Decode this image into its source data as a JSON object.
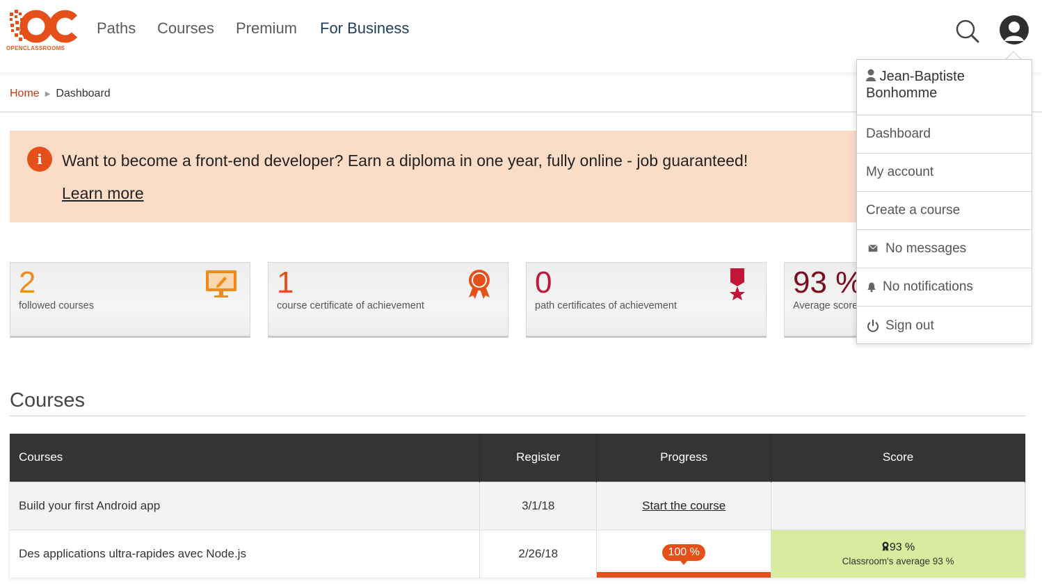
{
  "header": {
    "logo_text": "OPENCLASSROOMS",
    "nav": [
      {
        "label": "Paths"
      },
      {
        "label": "Courses"
      },
      {
        "label": "Premium"
      },
      {
        "label": "For Business"
      }
    ],
    "icons": [
      "search-icon",
      "user-avatar-icon"
    ]
  },
  "breadcrumb": {
    "home": "Home",
    "current": "Dashboard"
  },
  "banner": {
    "icon": "info-icon",
    "text": "Want to become a front-end developer? Earn a diploma in one year, fully online - job guaranteed!",
    "link": "Learn more",
    "color": "#fbdcc7"
  },
  "stats": [
    {
      "value": "2",
      "label": "followed courses",
      "icon": "monitor-pencil-icon",
      "color": "#f08a1c"
    },
    {
      "value": "1",
      "label": "course certificate of achievement",
      "icon": "ribbon-award-icon",
      "color": "#e5501a"
    },
    {
      "value": "0",
      "label": "path certificates of achievement",
      "icon": "star-medal-icon",
      "color": "#c0163a"
    },
    {
      "value": "93 %",
      "label": "Average score",
      "color": "#7a0f22"
    }
  ],
  "courses": {
    "title": "Courses",
    "columns": [
      "Courses",
      "Register",
      "Progress",
      "Score"
    ],
    "rows": [
      {
        "name": "Build your first Android app",
        "register": "3/1/18",
        "progress_link": "Start the course"
      },
      {
        "name": "Des applications ultra-rapides avec Node.js",
        "register": "2/26/18",
        "progress_label": "100 %",
        "progress_fraction": 1.0,
        "score": "93 %",
        "score_sub": "Classroom's average 93 %"
      }
    ]
  },
  "user_menu": {
    "user_name": "Jean-Baptiste Bonhomme",
    "items": [
      {
        "label": "Dashboard",
        "icon": ""
      },
      {
        "label": "My account",
        "icon": ""
      },
      {
        "label": "Create a course",
        "icon": ""
      },
      {
        "label": "No messages",
        "icon": "envelope-icon"
      },
      {
        "label": "No notifications",
        "icon": "bell-icon"
      },
      {
        "label": "Sign out",
        "icon": "power-icon"
      }
    ]
  },
  "colors": {
    "accent": "#e5501a",
    "nav_active": "#1d3d5c",
    "table_header": "#343434",
    "score_good": "#d9eb9f"
  }
}
